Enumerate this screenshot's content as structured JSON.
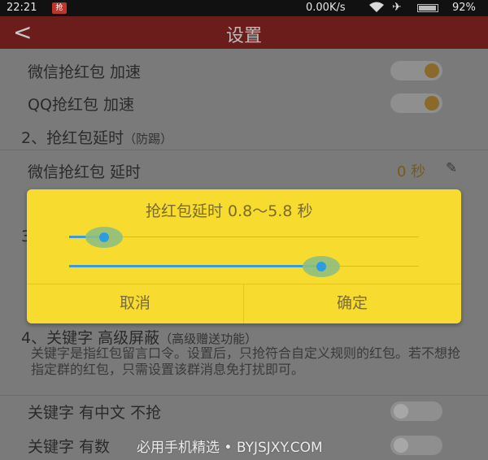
{
  "status": {
    "time": "22:21",
    "notif_badge": "抢",
    "net_speed": "0.00K/s",
    "battery": "92%",
    "icons": [
      "wifi-icon",
      "airplane-icon",
      "battery-icon"
    ]
  },
  "header": {
    "title": "设置",
    "back_icon": "back-arrow-icon"
  },
  "settings": {
    "wechat_speedup": {
      "label": "微信抢红包 加速",
      "on": true
    },
    "qq_speedup": {
      "label": "QQ抢红包 加速",
      "on": true
    },
    "section2": {
      "label": "2、抢红包延时",
      "sub": "（防踢）"
    },
    "wechat_delay": {
      "label": "微信抢红包 延时",
      "value": "0 秒"
    },
    "section3_peek": "3",
    "section4": {
      "label": "4、关键字 高级屏蔽",
      "sub": "（高级赠送功能）"
    },
    "keyword_desc": "关键字是指红包留言口令。设置后，只抢符合自定义规则的红包。若不想抢指定群的红包，只需设置该群消息免打扰即可。",
    "keyword_chinese": {
      "label": "关键字 有中文 不抢",
      "on": false
    },
    "keyword_number": {
      "label": "关键字 有数",
      "on": false
    }
  },
  "dialog": {
    "title": "抢红包延时 0.8～5.8 秒",
    "slider_min": {
      "fraction": 0.1
    },
    "slider_max": {
      "fraction": 0.72
    },
    "cancel_label": "取消",
    "confirm_label": "确定"
  },
  "watermark": "必用手机精选 • BYJSJXY.COM",
  "colors": {
    "accent": "#f7db2e",
    "slider": "#2b9de0",
    "title_bar": "#c0352b"
  }
}
